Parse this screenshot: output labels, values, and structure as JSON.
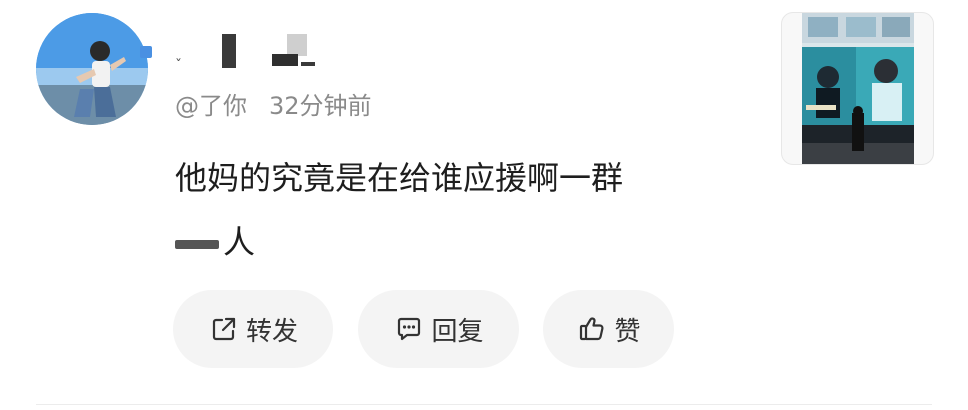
{
  "post": {
    "author_handle": "@了你",
    "time": "32分钟前",
    "content_line1": "他妈的究竟是在给谁应援啊一群",
    "content_line2": "人"
  },
  "actions": {
    "forward_label": "转发",
    "reply_label": "回复",
    "like_label": "赞"
  },
  "icons": {
    "forward": "share-external-icon",
    "reply": "comment-bubble-icon",
    "like": "thumbs-up-icon"
  }
}
